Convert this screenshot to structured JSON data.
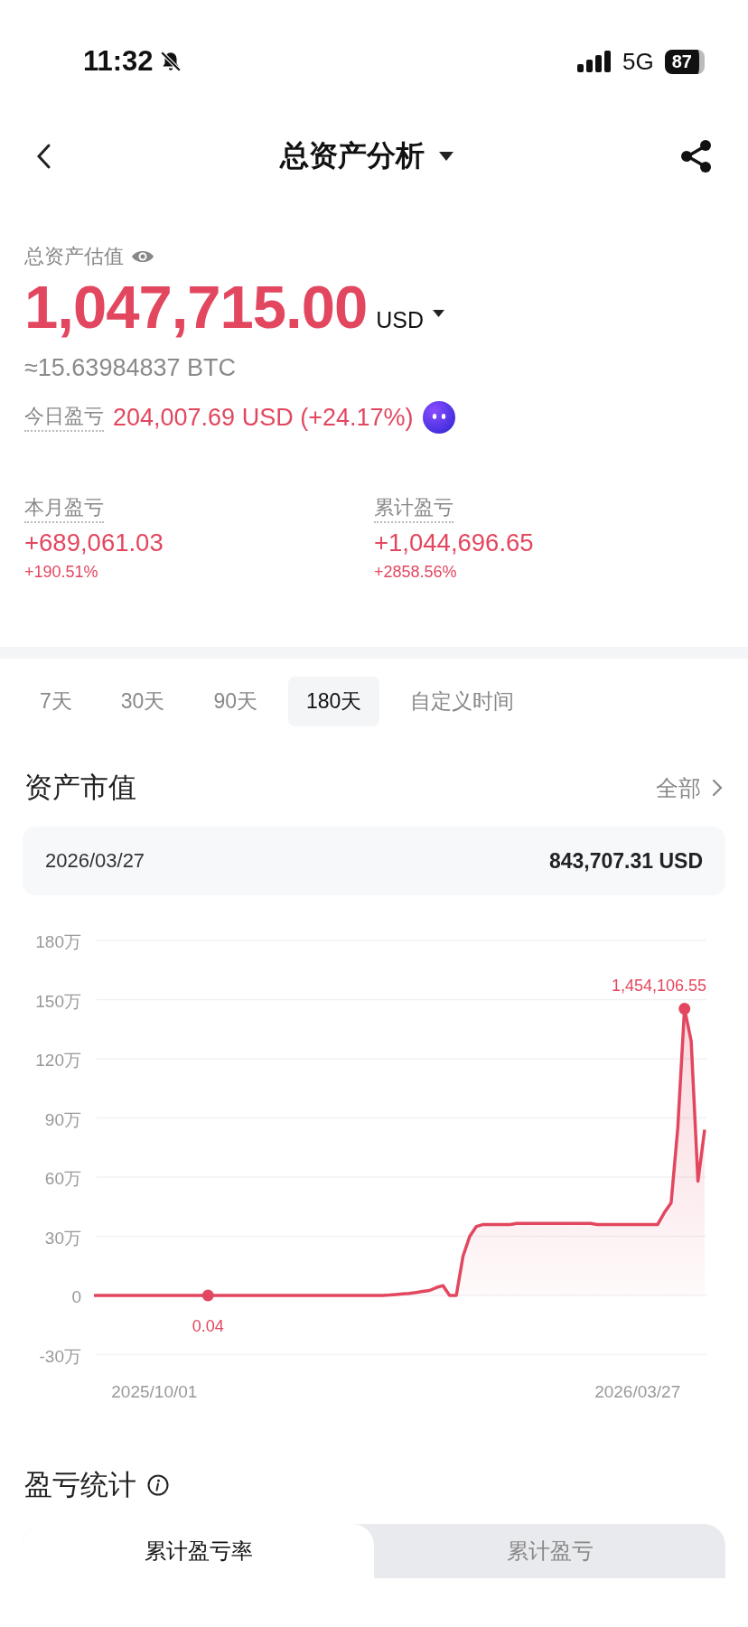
{
  "status_bar": {
    "time": "11:32",
    "network": "5G",
    "battery": "87"
  },
  "header": {
    "title": "总资产分析"
  },
  "summary": {
    "label": "总资产估值",
    "total": "1,047,715.00",
    "currency": "USD",
    "btc": "≈15.63984837 BTC",
    "today_label": "今日盈亏",
    "today_value": "204,007.69 USD (+24.17%)"
  },
  "stats": [
    {
      "label": "本月盈亏",
      "value": "+689,061.03",
      "percent": "+190.51%"
    },
    {
      "label": "累计盈亏",
      "value": "+1,044,696.65",
      "percent": "+2858.56%"
    }
  ],
  "periods": [
    {
      "label": "7天",
      "selected": false
    },
    {
      "label": "30天",
      "selected": false
    },
    {
      "label": "90天",
      "selected": false
    },
    {
      "label": "180天",
      "selected": true
    },
    {
      "label": "自定义时间",
      "selected": false
    }
  ],
  "asset_value": {
    "title": "资产市值",
    "more": "全部",
    "date": "2026/03/27",
    "amount": "843,707.31 USD",
    "chart_data": {
      "type": "line",
      "categories": [
        null,
        null,
        null,
        null,
        null,
        null,
        null,
        null,
        null,
        "2025/10/01",
        null,
        null,
        null,
        null,
        null,
        null,
        null,
        null,
        null,
        null,
        null,
        null,
        null,
        null,
        null,
        null,
        null,
        null,
        null,
        null,
        null,
        null,
        null,
        null,
        null,
        null,
        null,
        null,
        null,
        null,
        null,
        null,
        null,
        null,
        null,
        null,
        null,
        null,
        null,
        null,
        null,
        null,
        null,
        null,
        null,
        null,
        null,
        null,
        null,
        null,
        null,
        null,
        null,
        null,
        null,
        null,
        null,
        null,
        null,
        null,
        null,
        null,
        null,
        null,
        null,
        null,
        null,
        null,
        null,
        null,
        null,
        "2026/03/27",
        null,
        null,
        null,
        null,
        null,
        null,
        null,
        null,
        null,
        null
      ],
      "grid": true,
      "series": [
        {
          "color": "#e2475f",
          "values": [
            0,
            0,
            0,
            0,
            0,
            0,
            0,
            0,
            0,
            0,
            0,
            0,
            0,
            0,
            0,
            0,
            0,
            4e-06,
            0,
            0,
            0,
            0,
            0,
            0,
            0,
            0,
            0,
            0,
            0,
            0,
            0,
            0,
            0,
            0,
            0,
            0,
            0,
            0,
            0,
            0,
            0,
            0,
            0,
            0,
            0.2,
            0.5,
            0.8,
            1,
            1.5,
            2,
            2.5,
            4,
            5,
            0,
            0,
            20,
            30,
            35,
            36,
            36,
            36,
            36,
            36,
            36.5,
            36.5,
            36.5,
            36.5,
            36.5,
            36.5,
            36.5,
            36.5,
            36.5,
            36.5,
            36.5,
            36.5,
            36,
            36,
            36,
            36,
            36,
            36,
            36,
            36,
            36,
            36,
            42,
            47,
            85,
            145.4,
            129,
            58,
            84
          ]
        }
      ],
      "ylim": [
        -30,
        180
      ],
      "yticks": [
        {
          "value": 180,
          "label": "180万"
        },
        {
          "value": 150,
          "label": "150万"
        },
        {
          "value": 120,
          "label": "120万"
        },
        {
          "value": 90,
          "label": "90万"
        },
        {
          "value": 60,
          "label": "60万"
        },
        {
          "value": 30,
          "label": "30万"
        },
        {
          "value": 0,
          "label": "0"
        },
        {
          "value": -30,
          "label": "-30万"
        }
      ],
      "annotations": [
        "0.04",
        "1,454,106.55"
      ]
    }
  },
  "pnl_stats": {
    "title": "盈亏统计",
    "tabs": [
      {
        "label": "累计盈亏率",
        "selected": true
      },
      {
        "label": "累计盈亏",
        "selected": false
      }
    ]
  }
}
